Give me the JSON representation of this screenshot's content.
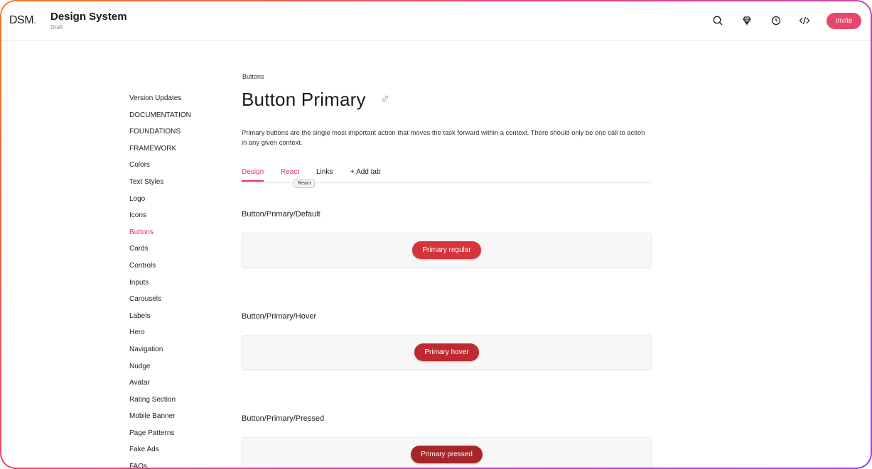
{
  "header": {
    "logo_text": "DSM",
    "logo_dot": ".",
    "title": "Design System",
    "subtitle": "Draft",
    "icons": [
      "search-icon",
      "gem-icon",
      "history-icon",
      "code-icon"
    ],
    "invite_label": "Invite"
  },
  "sidebar": {
    "items": [
      {
        "label": "Version Updates"
      },
      {
        "label": "DOCUMENTATION"
      },
      {
        "label": "FOUNDATIONS"
      },
      {
        "label": "FRAMEWORK"
      },
      {
        "label": "Colors"
      },
      {
        "label": "Text Styles"
      },
      {
        "label": "Logo"
      },
      {
        "label": "Icons"
      },
      {
        "label": "Buttons"
      },
      {
        "label": "Cards"
      },
      {
        "label": "Controls"
      },
      {
        "label": "Inputs"
      },
      {
        "label": "Carousels"
      },
      {
        "label": "Labels"
      },
      {
        "label": "Hero"
      },
      {
        "label": "Navigation"
      },
      {
        "label": "Nudge"
      },
      {
        "label": "Avatar"
      },
      {
        "label": "Rating Section"
      },
      {
        "label": "Mobile Banner"
      },
      {
        "label": "Page Patterns"
      },
      {
        "label": "Fake Ads"
      },
      {
        "label": "FAQs"
      }
    ],
    "active": "Buttons"
  },
  "main": {
    "breadcrumb": "Buttons",
    "title": "Button Primary",
    "description": "Primary buttons are the single most important action that moves the task forward within a context. There should only be one call to action in any given context.",
    "tabs": [
      {
        "label": "Design"
      },
      {
        "label": "React"
      },
      {
        "label": "Links"
      },
      {
        "label": "+ Add tab"
      }
    ],
    "tooltip": "React",
    "sections": [
      {
        "title": "Button/Primary/Default",
        "button_label": "Primary regular",
        "color": "#d6333b"
      },
      {
        "title": "Button/Primary/Hover",
        "button_label": "Primary hover",
        "color": "#bf2a31"
      },
      {
        "title": "Button/Primary/Pressed",
        "button_label": "Primary pressed",
        "color": "#a82529"
      }
    ]
  },
  "colors": {
    "accent": "#e2365f",
    "invite": "#e8466c"
  }
}
